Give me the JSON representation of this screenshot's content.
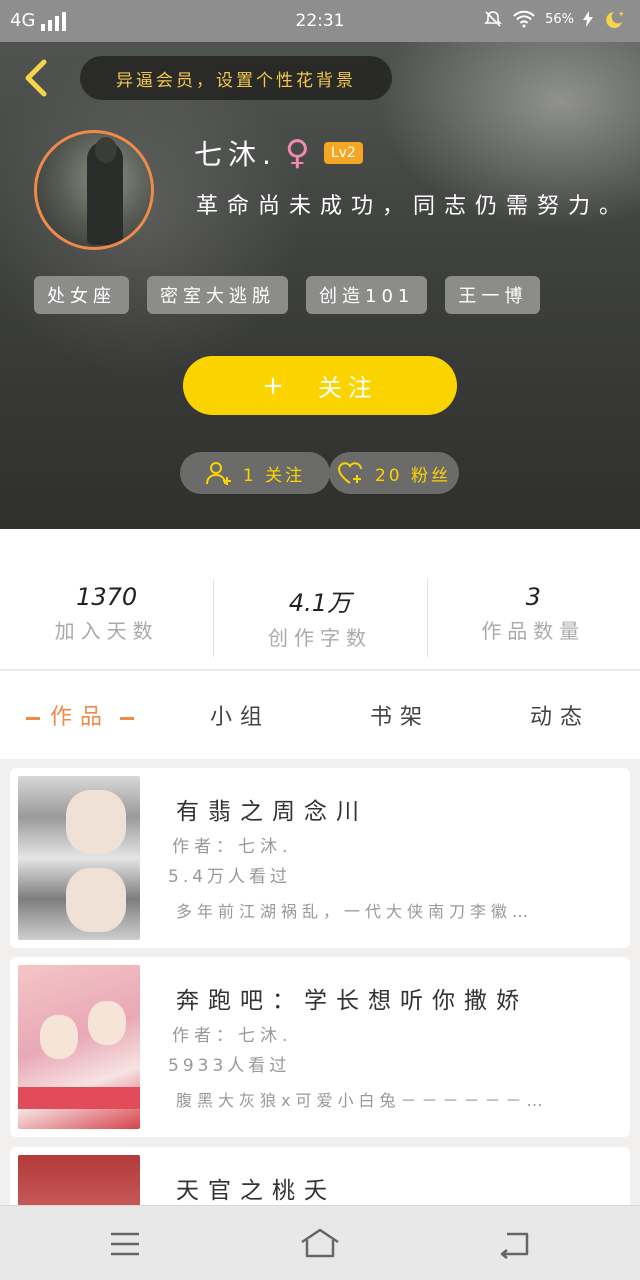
{
  "status_bar": {
    "network": "4G",
    "time": "22:31",
    "battery": "56%",
    "icons": [
      "mute-bell-icon",
      "wifi-icon",
      "charging-icon",
      "moon-star-icon"
    ]
  },
  "header": {
    "bg_tip": "异逼会员，设置个性花背景",
    "name": "七沐.",
    "gender_symbol": "♀",
    "level": "Lv2",
    "motto": "革命尚未成功，同志仍需努力。",
    "tags": [
      "处女座",
      "密室大逃脱",
      "创造101",
      "王一博"
    ],
    "follow_plus": "+",
    "follow_label": "关注",
    "following_label": "1 关注",
    "fans_label": "20 粉丝"
  },
  "stats": [
    {
      "value": "1370",
      "label": "加入天数"
    },
    {
      "value": "4.1万",
      "label": "创作字数"
    },
    {
      "value": "3",
      "label": "作品数量"
    }
  ],
  "tabs": [
    {
      "label": "作品",
      "active": true
    },
    {
      "label": "小组",
      "active": false
    },
    {
      "label": "书架",
      "active": false
    },
    {
      "label": "动态",
      "active": false
    }
  ],
  "works": [
    {
      "title": "有翡之周念川",
      "author": "作者：七沐.",
      "views": "5.4万人看过",
      "desc": "多年前江湖祸乱，一代大侠南刀李徽…"
    },
    {
      "title": "奔跑吧：学长想听你撒娇",
      "author": "作者：七沐.",
      "views": "5933人看过",
      "desc": "腹黑大灰狼x可爱小白兔－－－－－－…"
    },
    {
      "title": "天官之桃夭"
    }
  ],
  "colors": {
    "accent_yellow": "#fbd400",
    "accent_orange": "#f08a4b",
    "tag_gray": "#8c8c8a"
  },
  "nav": {
    "icons": [
      "menu-icon",
      "home-icon",
      "back-icon"
    ]
  }
}
